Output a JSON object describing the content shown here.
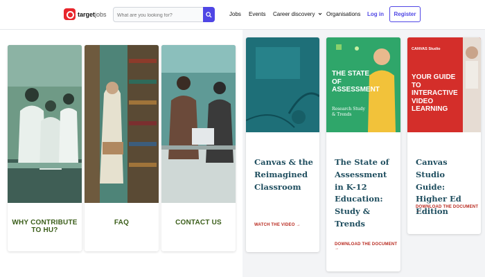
{
  "header": {
    "logo_text": "target",
    "logo_sub": "jobs",
    "search_placeholder": "What are you looking for?",
    "nav": {
      "jobs": "Jobs",
      "events": "Events",
      "career_discovery": "Career discovery",
      "organisations": "Organisations"
    },
    "login": "Log in",
    "register": "Register"
  },
  "left_cards": [
    {
      "caption": "WHY CONTRIBUTE TO HU?"
    },
    {
      "caption": "FAQ"
    },
    {
      "caption": "CONTACT US"
    }
  ],
  "right_cards": [
    {
      "title": "Canvas & the Reimagined Classroom",
      "link": "WATCH THE VIDEO"
    },
    {
      "title": "The State of Assessment in K-12 Education: Study & Trends",
      "link": "DOWNLOAD THE DOCUMENT",
      "banner_title": "THE STATE OF ASSESSMENT",
      "banner_sub": "Research Study & Trends"
    },
    {
      "title": "Canvas Studio Guide: Higher Ed Edition",
      "link": "DOWNLOAD THE DOCUMENT",
      "banner_brand": "CANVAS Studio",
      "banner_title": "YOUR GUIDE TO INTERACTIVE VIDEO LEARNING"
    }
  ],
  "colors": {
    "accent": "#4f46e5",
    "logo_red": "#e8262c",
    "caption_green": "#3b5e1a",
    "link_red": "#b8281e",
    "title_teal": "#1f4e5f"
  }
}
